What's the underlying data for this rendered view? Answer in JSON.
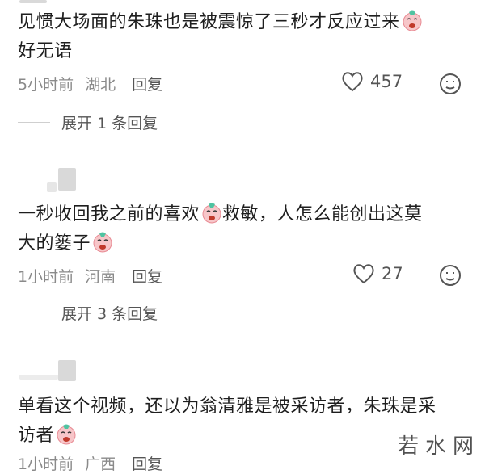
{
  "comments": [
    {
      "lines": [
        "见惯大场面的朱珠也是被震惊了三秒才反应过来",
        "好无语"
      ],
      "time": "5小时前",
      "location": "湖北",
      "reply_label": "回复",
      "likes": "457",
      "expand_label": "展开 1 条回复"
    },
    {
      "lines": [
        "一秒收回我之前的喜欢",
        "救敏，人怎么能创出这莫",
        "大的篓子"
      ],
      "time": "1小时前",
      "location": "河南",
      "reply_label": "回复",
      "likes": "27",
      "expand_label": "展开 3 条回复"
    },
    {
      "lines": [
        "单看这个视频，还以为翁清雅是被采访者，朱珠是采",
        "访者"
      ],
      "time": "1小时前",
      "location": "广西",
      "reply_label": "回复"
    }
  ],
  "watermark": "若水网",
  "icons": {
    "heart": "heart-icon",
    "comment": "comment-emoji-icon",
    "cry_emoji": "crying-face-emoji-icon"
  },
  "colors": {
    "muted": "#8a8a8a",
    "text": "#1e1e1e"
  }
}
